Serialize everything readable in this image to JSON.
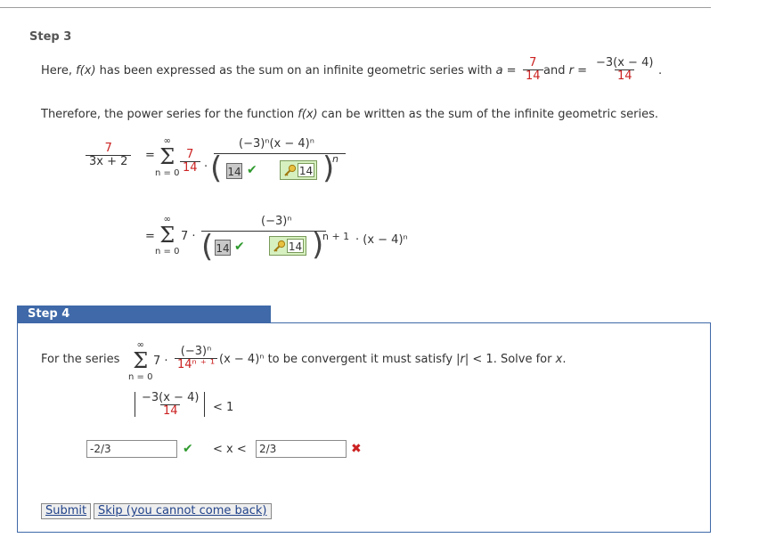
{
  "step3": {
    "title": "Step 3",
    "line1_pre": "Here, ",
    "line1_fx": "f(x)",
    "line1_mid": " has been expressed as the sum on an infinite geometric series with ",
    "a_label": "a",
    "equals": " = ",
    "a_num": "7",
    "a_den": "14",
    "and_r": " and ",
    "r_label": "r",
    "r_num": "−3(x − 4)",
    "r_den": "14",
    "period": ".",
    "line2_pre": "Therefore, the power series for the function ",
    "line2_fx": "f(x)",
    "line2_post": " can be written as the sum of the infinite geometric series.",
    "lhs_num": "7",
    "lhs_den": "3x + 2",
    "eq1": "=",
    "sum_top": "∞",
    "sum_sym": "Σ",
    "sum_bottom": "n = 0",
    "term1_num": "7",
    "term1_den": "14",
    "dot": "·",
    "term2_num": "(−3)ⁿ(x − 4)ⁿ",
    "box_value": "14",
    "check": "✔",
    "key_value": "14",
    "exp_n": "n",
    "eq2": "=",
    "row2_coef": "7 ·",
    "row2_num": "(−3)ⁿ",
    "row2_exp": "n + 1",
    "row2_tail": "· (x − 4)ⁿ"
  },
  "step4": {
    "title": "Step 4",
    "for_series": "For the series",
    "coef": "7 ·",
    "frac_num": "(−3)ⁿ",
    "frac_den": "14ⁿ ⁺ ¹",
    "tail_pre": "(x − 4)ⁿ to be convergent it must satisfy ",
    "abs_r": "|r|",
    "tail_post": " < 1. Solve for ",
    "x_var": "x",
    "tail_end": ".",
    "abs_num": "−3(x − 4)",
    "abs_den": "14",
    "lt_one": "< 1",
    "input_left": "-2/3",
    "check": "✔",
    "ineq": "< x <",
    "input_right": "2/3",
    "cross": "✖",
    "submit": "Submit",
    "skip": "Skip (you cannot come back)"
  },
  "colors": {
    "accent": "#3f69a8",
    "red": "#cc2222",
    "green": "#2e9a2e"
  }
}
